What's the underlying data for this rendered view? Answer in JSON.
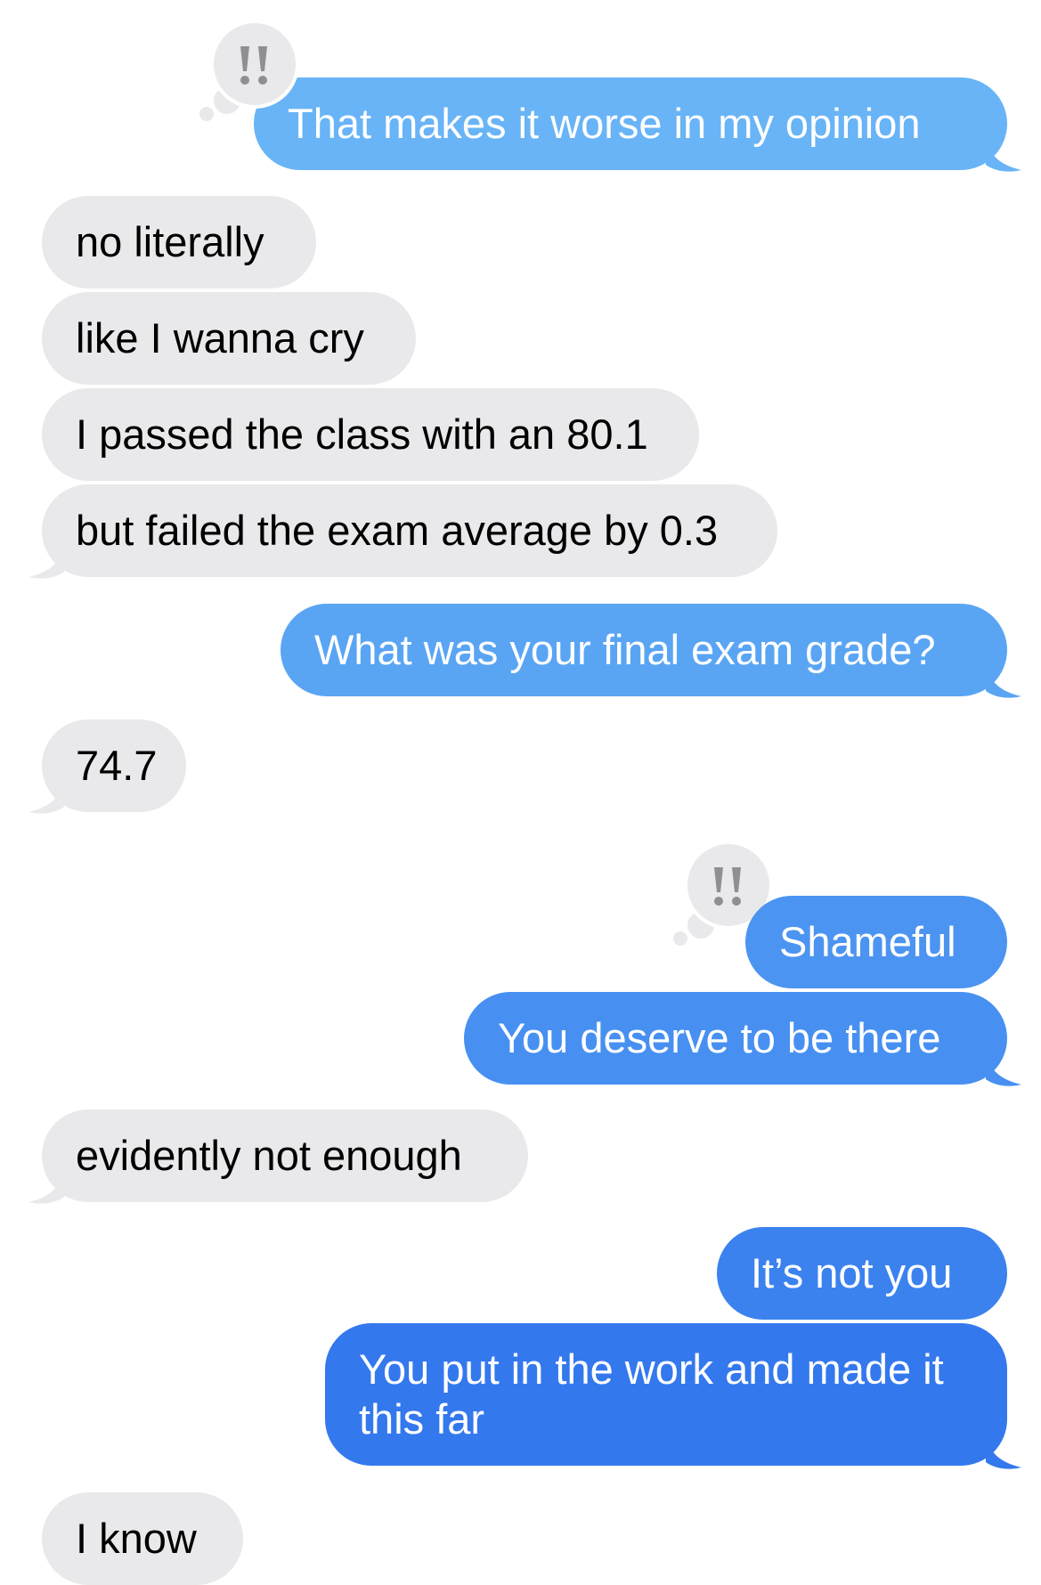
{
  "messages": [
    {
      "id": "m1",
      "direction": "outgoing",
      "text": "That makes it worse in my opinion",
      "reaction": "exclamation-tapback"
    },
    {
      "id": "m2",
      "direction": "incoming",
      "text": "no literally"
    },
    {
      "id": "m3",
      "direction": "incoming",
      "text": "like I wanna cry"
    },
    {
      "id": "m4",
      "direction": "incoming",
      "text": "I passed the class with an 80.1"
    },
    {
      "id": "m5",
      "direction": "incoming",
      "text": "but failed the exam average by 0.3"
    },
    {
      "id": "m6",
      "direction": "outgoing",
      "text": "What was your final exam grade?"
    },
    {
      "id": "m7",
      "direction": "incoming",
      "text": "74.7"
    },
    {
      "id": "m8",
      "direction": "outgoing",
      "text": "Shameful",
      "reaction": "exclamation-tapback"
    },
    {
      "id": "m9",
      "direction": "outgoing",
      "text": "You deserve to be there"
    },
    {
      "id": "m10",
      "direction": "incoming",
      "text": "evidently not enough"
    },
    {
      "id": "m11",
      "direction": "outgoing",
      "text": "It’s not you"
    },
    {
      "id": "m12",
      "direction": "outgoing",
      "text": "You put in the work and made it this far"
    },
    {
      "id": "m13",
      "direction": "incoming",
      "text": "I know"
    }
  ],
  "colors": {
    "incoming_bubble": "#e9e9eb",
    "outgoing_gradient_top": "#6bb8f7",
    "outgoing_gradient_bottom": "#2f74ee",
    "tapback_glyph": "#8e8e93"
  },
  "icons": {
    "reaction": "double-exclamation-icon"
  }
}
